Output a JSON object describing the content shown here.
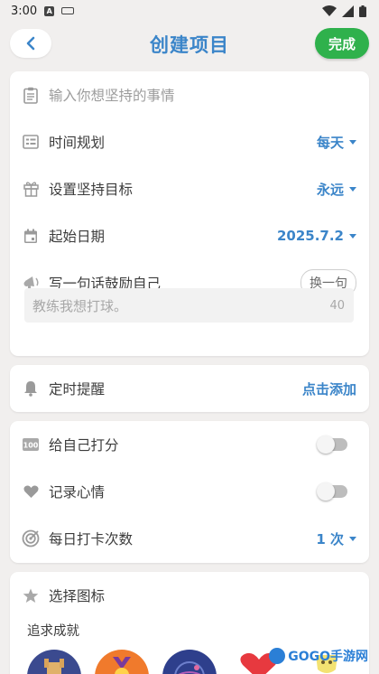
{
  "status_bar": {
    "time": "3:00",
    "notif_icon_letter": "A"
  },
  "header": {
    "title": "创建项目",
    "done_label": "完成"
  },
  "form": {
    "name_placeholder": "输入你想坚持的事情",
    "schedule": {
      "label": "时间规划",
      "value": "每天"
    },
    "goal": {
      "label": "设置坚持目标",
      "value": "永远"
    },
    "start_date": {
      "label": "起始日期",
      "value": "2025.7.2"
    },
    "motto": {
      "label": "写一句话鼓励自己",
      "swap_label": "换一句",
      "text": "教练我想打球。",
      "char_remaining": "40"
    }
  },
  "reminder": {
    "label": "定时提醒",
    "action": "点击添加"
  },
  "options": {
    "score": {
      "label": "给自己打分",
      "enabled": false
    },
    "mood": {
      "label": "记录心情",
      "enabled": false
    },
    "checkins": {
      "label": "每日打卡次数",
      "value": "1 次"
    }
  },
  "icon_picker": {
    "label": "选择图标",
    "category": "追求成就",
    "icons": [
      "castle-icon",
      "medal-icon",
      "globe-icon",
      "heart-icon",
      "trophy-icon"
    ]
  },
  "watermark": {
    "text": "GOGO手游网"
  },
  "colors": {
    "accent": "#3b85c9",
    "done_green": "#2fb14c",
    "background": "#f1efee"
  }
}
